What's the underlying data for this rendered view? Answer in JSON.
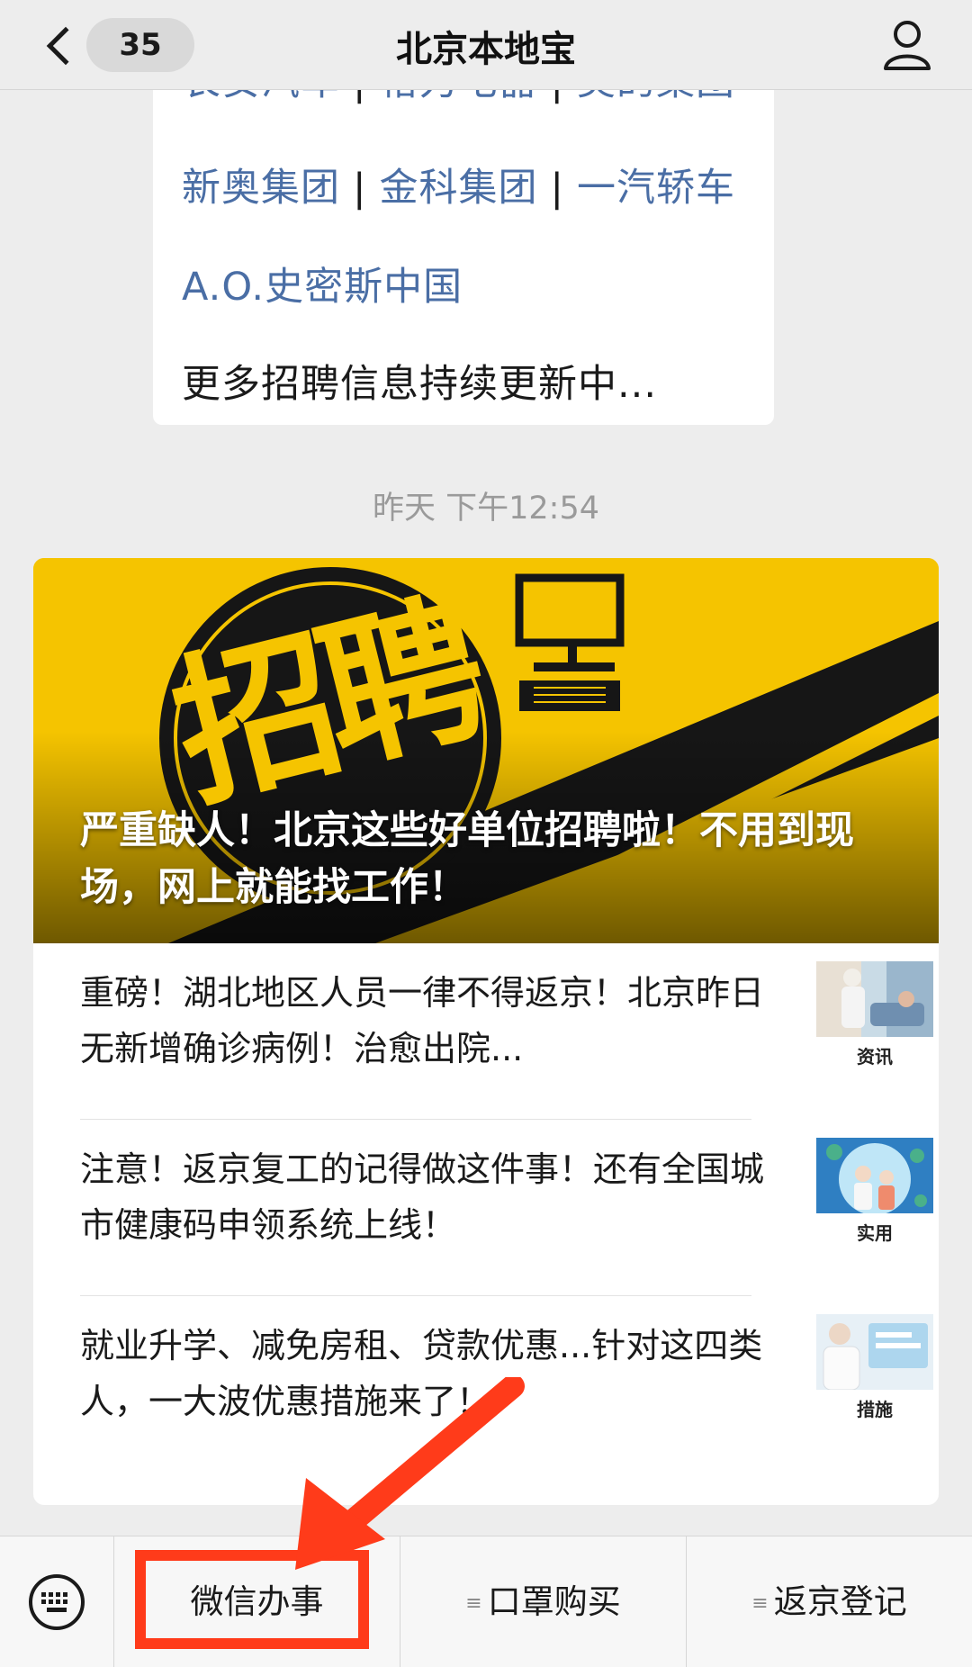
{
  "navbar": {
    "unread_count": "35",
    "title": "北京本地宝"
  },
  "previous_message": {
    "clipped_line": [
      "长安汽车",
      "格力电器",
      "美的集团"
    ],
    "line_2": [
      "新奥集团",
      "金科集团",
      "一汽轿车"
    ],
    "line_3": "A.O.史密斯中国",
    "line_4": "更多招聘信息持续更新中..."
  },
  "timestamp": "昨天 下午12:54",
  "article": {
    "cover_badge_text": "招聘",
    "cover_title": "严重缺人！北京这些好单位招聘啦！不用到现场，网上就能找工作！",
    "sub_items": [
      {
        "title": "重磅！湖北地区人员一律不得返京！北京昨日无新增确诊病例！治愈出院...",
        "thumb_label": "资讯"
      },
      {
        "title": "注意！返京复工的记得做这件事！还有全国城市健康码申领系统上线！",
        "thumb_label": "实用"
      },
      {
        "title": "就业升学、减免房租、贷款优惠...针对这四类人，一大波优惠措施来了！",
        "thumb_label": "措施"
      }
    ]
  },
  "menu": {
    "items": [
      "微信办事",
      "口罩购买",
      "返京登记"
    ],
    "separator": "|",
    "menu_glyph": "≡"
  },
  "colors": {
    "link": "#4a6ea5",
    "cover_yellow": "#f5c400",
    "annotation_red": "#ff3b1a"
  },
  "icons": [
    "back-chevron-icon",
    "profile-icon",
    "keyboard-icon",
    "menu-lines-icon",
    "computer-icon"
  ]
}
